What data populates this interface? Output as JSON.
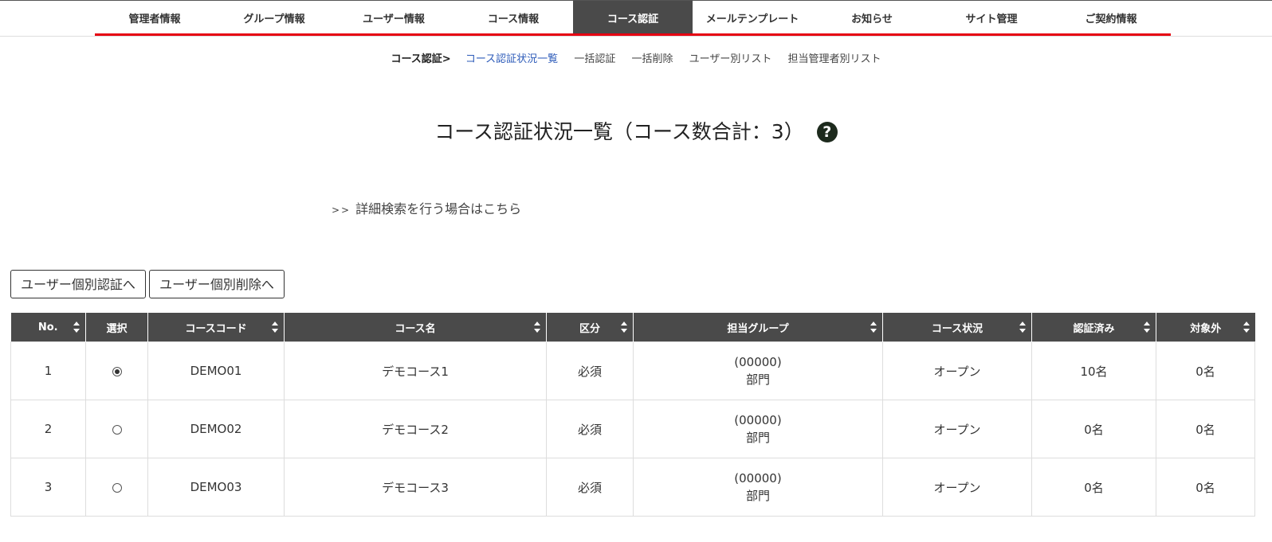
{
  "nav": {
    "items": [
      "管理者情報",
      "グループ情報",
      "ユーザー情報",
      "コース情報",
      "コース認証",
      "メールテンプレート",
      "お知らせ",
      "サイト管理",
      "ご契約情報"
    ],
    "active_index": 4
  },
  "subnav": {
    "head": "コース認証>",
    "current": "コース認証状況一覧",
    "links": [
      "一括認証",
      "一括削除",
      "ユーザー別リスト",
      "担当管理者別リスト"
    ]
  },
  "page": {
    "title": "コース認証状況一覧（コース数合計：3）",
    "help_icon": "?",
    "advanced_search_arrows": ">>",
    "advanced_search": "詳細検索を行う場合はこちら"
  },
  "buttons": {
    "individual_auth": "ユーザー個別認証へ",
    "individual_delete": "ユーザー個別削除へ"
  },
  "table": {
    "columns": [
      "No.",
      "選択",
      "コースコード",
      "コース名",
      "区分",
      "担当グループ",
      "コース状況",
      "認証済み",
      "対象外"
    ],
    "rows": [
      {
        "no": "1",
        "selected": true,
        "code": "DEMO01",
        "name": "デモコース1",
        "kubun": "必須",
        "group_code": "(00000)",
        "group_name": "部門",
        "status": "オープン",
        "certified": "10名",
        "excluded": "0名"
      },
      {
        "no": "2",
        "selected": false,
        "code": "DEMO02",
        "name": "デモコース2",
        "kubun": "必須",
        "group_code": "(00000)",
        "group_name": "部門",
        "status": "オープン",
        "certified": "0名",
        "excluded": "0名"
      },
      {
        "no": "3",
        "selected": false,
        "code": "DEMO03",
        "name": "デモコース3",
        "kubun": "必須",
        "group_code": "(00000)",
        "group_name": "部門",
        "status": "オープン",
        "certified": "0名",
        "excluded": "0名"
      }
    ]
  },
  "colors": {
    "accent": "#e60012",
    "header_bg": "#4a4a4a",
    "link": "#2d5bb9"
  }
}
